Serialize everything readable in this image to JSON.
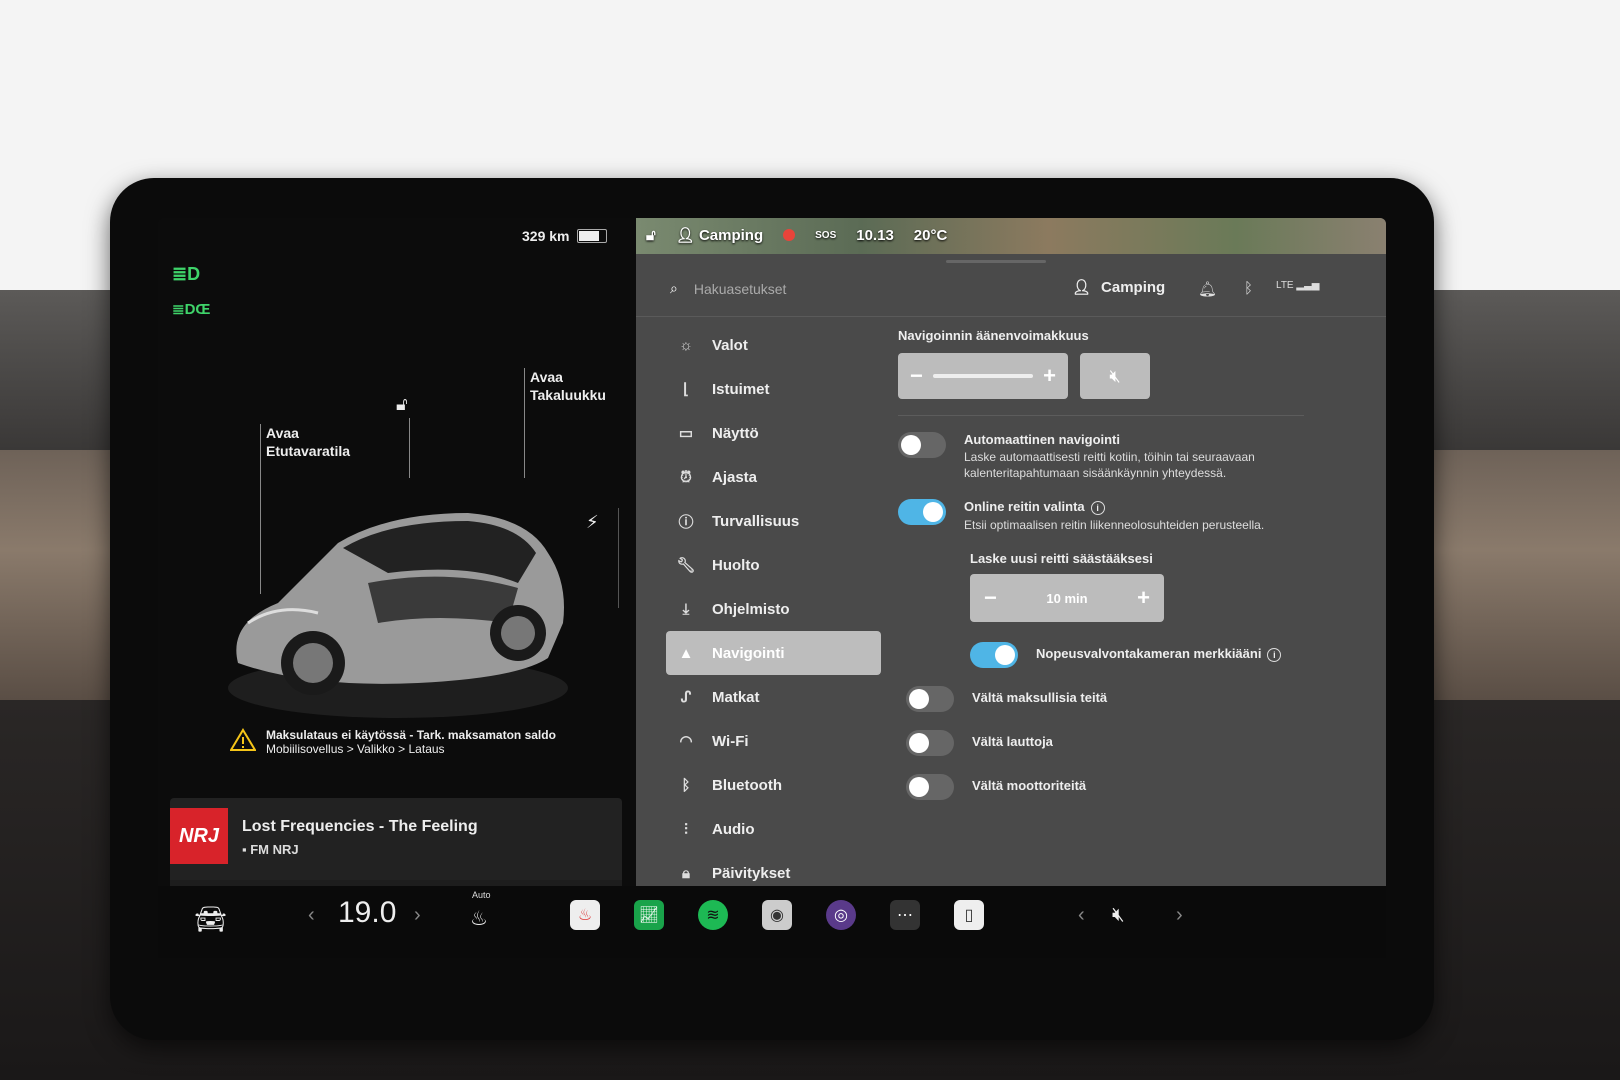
{
  "status": {
    "range": "329 km",
    "profile": "Camping",
    "time": "10.13",
    "sos": "SOS",
    "outside_temp": "20°C"
  },
  "car_panel": {
    "open_frunk": [
      "Avaa",
      "Etutavaratila"
    ],
    "open_trunk": [
      "Avaa",
      "Takaluukku"
    ],
    "warning_title": "Maksulataus ei käytössä - Tark. maksamaton saldo",
    "warning_path": "Mobiilisovellus > Valikko > Lataus"
  },
  "media": {
    "logo": "NRJ",
    "song": "Lost Frequencies - The Feeling",
    "station": "FM NRJ"
  },
  "topbar": {
    "search_placeholder": "Hakuasetukset",
    "profile": "Camping",
    "lte": "LTE"
  },
  "menu": [
    {
      "label": "Valot",
      "icon": "light-icon"
    },
    {
      "label": "Istuimet",
      "icon": "seat-icon"
    },
    {
      "label": "Näyttö",
      "icon": "display-icon"
    },
    {
      "label": "Ajasta",
      "icon": "clock-icon"
    },
    {
      "label": "Turvallisuus",
      "icon": "safety-icon"
    },
    {
      "label": "Huolto",
      "icon": "wrench-icon"
    },
    {
      "label": "Ohjelmisto",
      "icon": "download-icon"
    },
    {
      "label": "Navigointi",
      "icon": "navigation-icon"
    },
    {
      "label": "Matkat",
      "icon": "trips-icon"
    },
    {
      "label": "Wi-Fi",
      "icon": "wifi-icon"
    },
    {
      "label": "Bluetooth",
      "icon": "bluetooth-icon"
    },
    {
      "label": "Audio",
      "icon": "audio-icon"
    },
    {
      "label": "Päivitykset",
      "icon": "lock-icon"
    }
  ],
  "settings": {
    "volume_label": "Navigoinnin äänenvoimakkuus",
    "auto_nav_title": "Automaattinen navigointi",
    "auto_nav_desc": "Laske automaattisesti reitti kotiin, töihin tai seuraavaan kalenteritapahtumaan sisäänkäynnin yhteydessä.",
    "auto_nav_on": false,
    "online_route_title": "Online reitin valinta",
    "online_route_desc": "Etsii optimaalisen reitin liikenneolosuhteiden perusteella.",
    "online_route_on": true,
    "reroute_label": "Laske uusi reitti säästääksesi",
    "reroute_value": "10 min",
    "speed_camera_label": "Nopeusvalvontakameran merkkiääni",
    "speed_camera_on": true,
    "avoid_tolls": "Vältä maksullisia teitä",
    "avoid_ferries": "Vältä lauttoja",
    "avoid_highways": "Vältä moottoriteitä"
  },
  "bottom": {
    "temperature": "19.0",
    "seat_heat_label": "Auto"
  },
  "colors": {
    "accent": "#4fb5e6",
    "headlight_green": "#3fd46a",
    "panel": "#4a4a4a"
  }
}
